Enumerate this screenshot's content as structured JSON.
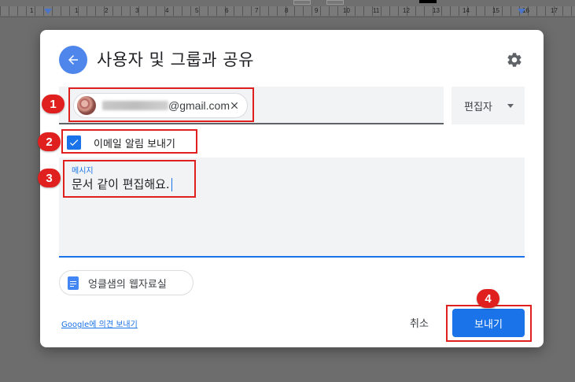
{
  "ruler": {
    "numbers": [
      "1",
      "1",
      "2",
      "3",
      "4",
      "5",
      "6",
      "7",
      "8",
      "9",
      "10",
      "11",
      "12",
      "13",
      "14",
      "15",
      "16",
      "17"
    ]
  },
  "dialog": {
    "title": "사용자 및 그룹과 공유",
    "recipient": {
      "email_suffix": "@gmail.com"
    },
    "role": {
      "selected": "편집자"
    },
    "notify": {
      "label": "이메일 알림 보내기",
      "checked": true
    },
    "message": {
      "label": "메시지",
      "text": "문서 같이 편집해요."
    },
    "document_chip": {
      "label": "엉클샘의 웹자료실"
    },
    "feedback_link": "Google에 의견 보내기",
    "cancel_label": "취소",
    "send_label": "보내기"
  },
  "annotations": {
    "badge_1": "1",
    "badge_2": "2",
    "badge_3": "3",
    "badge_4": "4",
    "color": "#e0201f"
  },
  "colors": {
    "accent": "#1a73e8",
    "back_button": "#4f86ec"
  }
}
